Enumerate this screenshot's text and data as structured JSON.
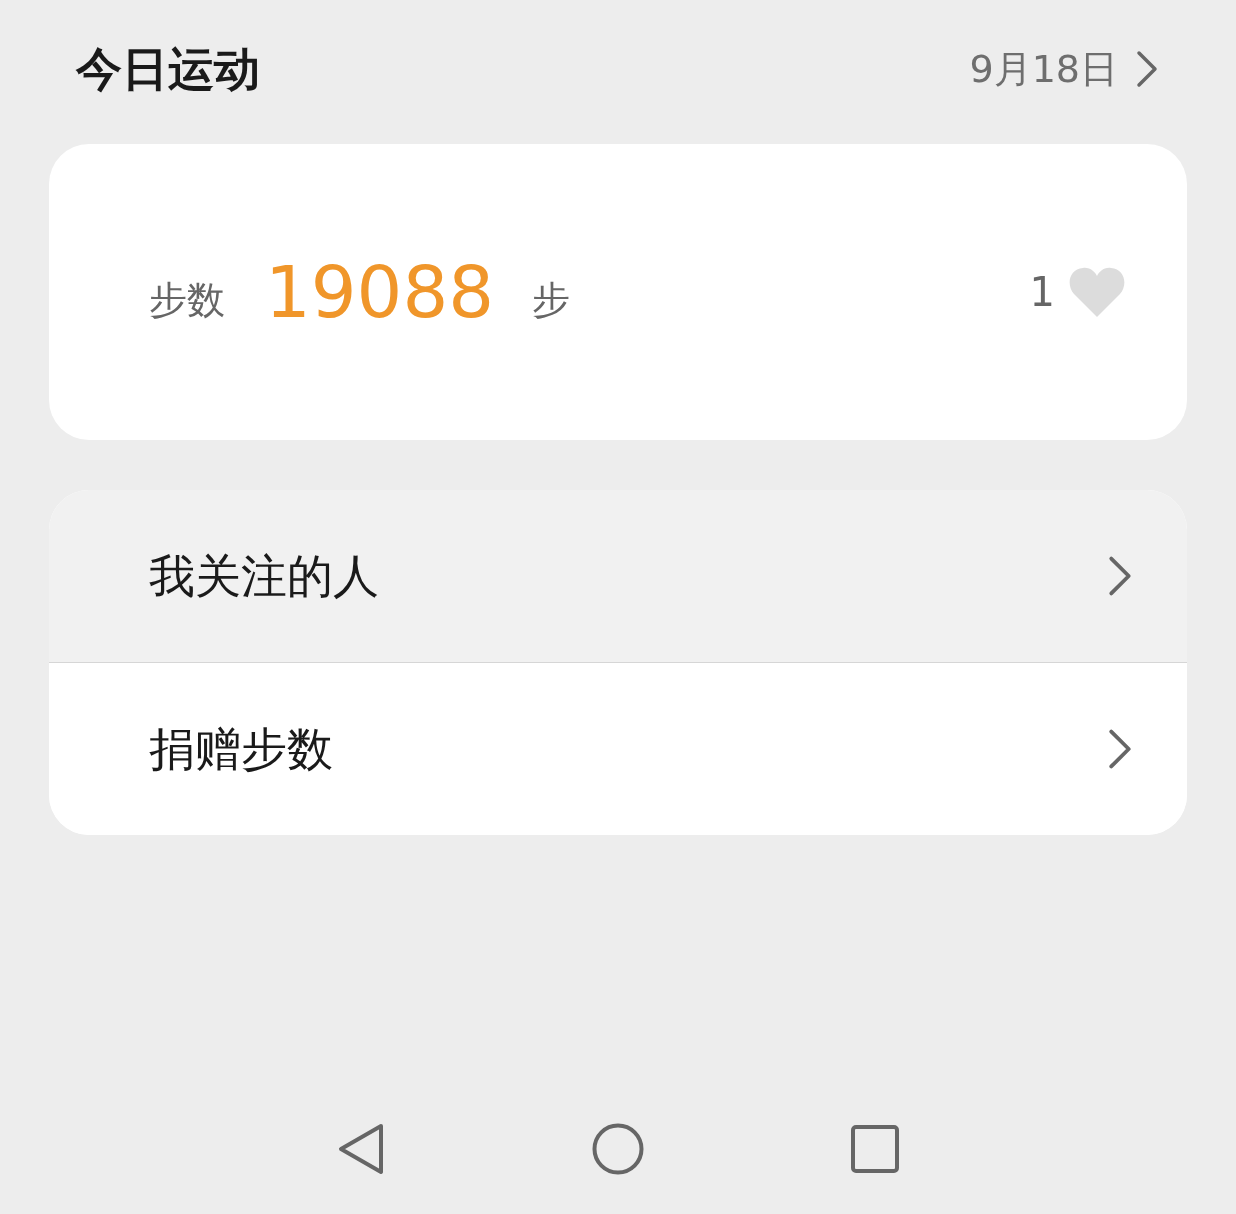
{
  "header": {
    "title": "今日运动",
    "date": "9月18日"
  },
  "steps_card": {
    "label": "步数",
    "value": "19088",
    "unit": "步",
    "likes": "1",
    "liked": false
  },
  "menu": [
    {
      "label": "我关注的人",
      "selected": true
    },
    {
      "label": "捐赠步数",
      "selected": false
    }
  ]
}
